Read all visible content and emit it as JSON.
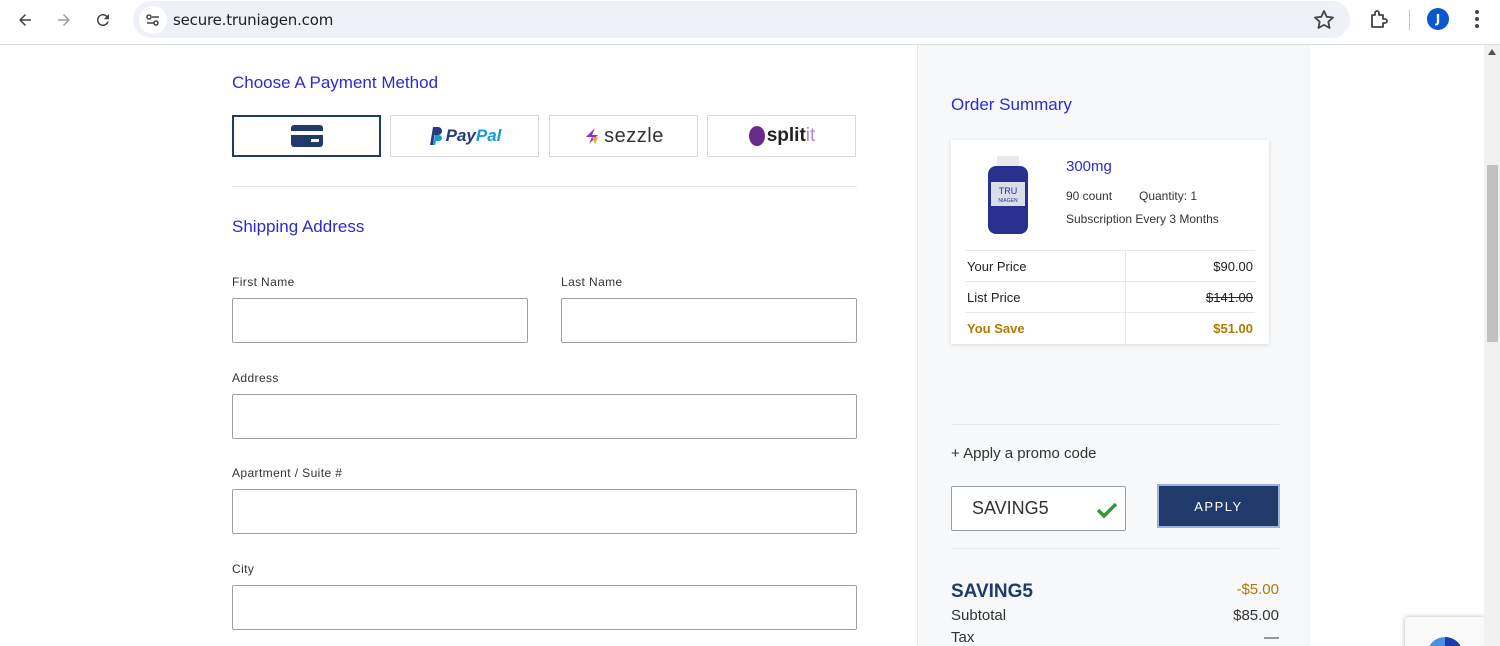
{
  "browser": {
    "url": "secure.truniagen.com",
    "avatar_letter": "J"
  },
  "payment": {
    "title": "Choose A Payment Method",
    "options": [
      {
        "name": "card",
        "icon": "credit-card-icon"
      },
      {
        "name": "PayPal",
        "label_pay": "Pay",
        "label_pal": "Pal"
      },
      {
        "name": "sezzle",
        "label": "sezzle"
      },
      {
        "name": "splitit",
        "label_split": "split",
        "label_it": "it"
      }
    ]
  },
  "shipping": {
    "title": "Shipping Address",
    "first_name_label": "First Name",
    "last_name_label": "Last Name",
    "address_label": "Address",
    "apartment_label": "Apartment / Suite #",
    "city_label": "City"
  },
  "order_summary": {
    "title": "Order Summary",
    "product": {
      "name": "300mg",
      "count": "90 count",
      "quantity": "Quantity: 1",
      "subscription": "Subscription Every 3 Months",
      "bottle_text_1": "TRU",
      "bottle_text_2": "NIAGEN"
    },
    "prices": {
      "your_price_label": "Your Price",
      "your_price": "$90.00",
      "list_price_label": "List Price",
      "list_price": "$141.00",
      "you_save_label": "You Save",
      "you_save": "$51.00"
    }
  },
  "promo": {
    "link_text": "+ Apply a promo code",
    "input_value": "SAVING5",
    "apply_label": "APPLY",
    "applied_code": "SAVING5",
    "discount": "-$5.00"
  },
  "totals": {
    "subtotal_label": "Subtotal",
    "subtotal": "$85.00",
    "tax_label": "Tax",
    "tax": "—"
  },
  "colors": {
    "accent_blue": "#2b2bd1",
    "navy": "#1f3a6b",
    "gold": "#b07a00"
  }
}
